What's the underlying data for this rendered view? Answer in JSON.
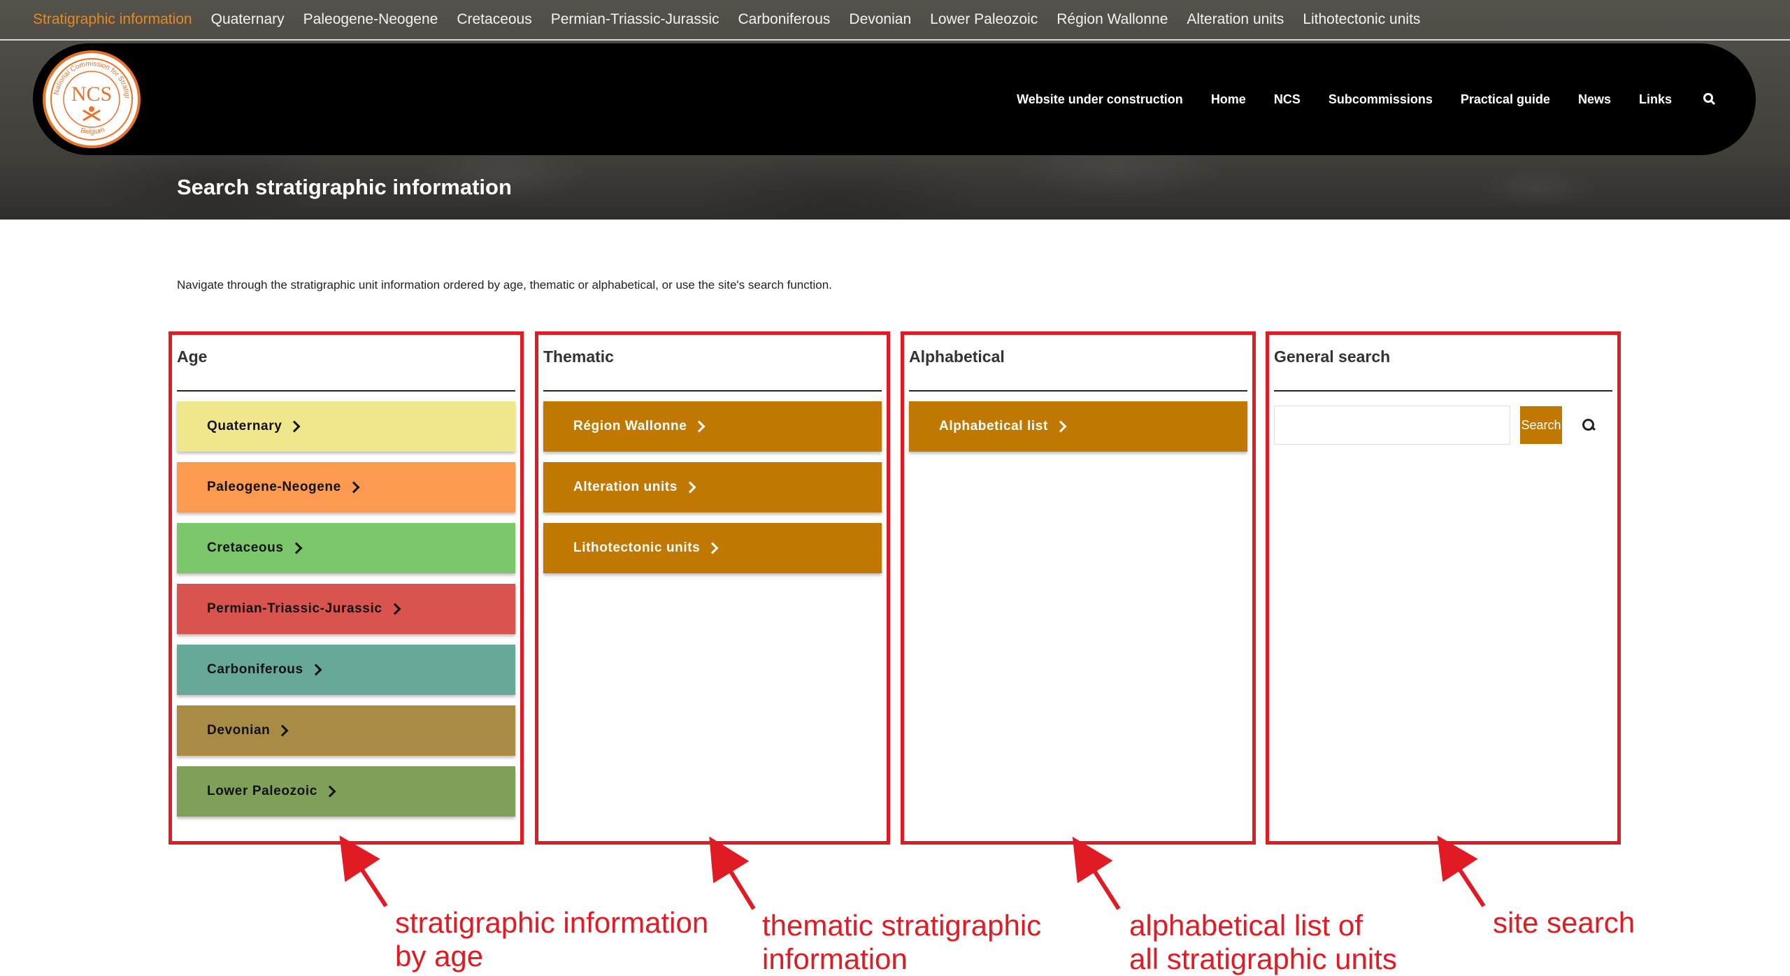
{
  "top_nav": {
    "items": [
      {
        "label": "Stratigraphic information",
        "active": true
      },
      {
        "label": "Quaternary"
      },
      {
        "label": "Paleogene-Neogene"
      },
      {
        "label": "Cretaceous"
      },
      {
        "label": "Permian-Triassic-Jurassic"
      },
      {
        "label": "Carboniferous"
      },
      {
        "label": "Devonian"
      },
      {
        "label": "Lower Paleozoic"
      },
      {
        "label": "Région Wallonne"
      },
      {
        "label": "Alteration units"
      },
      {
        "label": "Lithotectonic units"
      }
    ]
  },
  "logo": {
    "text": "NCS",
    "ring_text": "National Commission for Stratigraphy",
    "ring_text_bottom": "Belgium"
  },
  "main_nav": {
    "items": [
      "Website under construction",
      "Home",
      "NCS",
      "Subcommissions",
      "Practical guide",
      "News",
      "Links"
    ],
    "search_icon": "search-icon"
  },
  "page": {
    "title": "Search stratigraphic information",
    "intro": "Navigate through the stratigraphic unit information ordered by age, thematic or alphabetical, or use the site's search function."
  },
  "panels": {
    "age": {
      "title": "Age",
      "buttons": [
        {
          "label": "Quaternary",
          "color": "#f0e68c"
        },
        {
          "label": "Paleogene-Neogene",
          "color": "#fd9a52"
        },
        {
          "label": "Cretaceous",
          "color": "#7cc66b"
        },
        {
          "label": "Permian-Triassic-Jurassic",
          "color": "#d9534f"
        },
        {
          "label": "Carboniferous",
          "color": "#67a899"
        },
        {
          "label": "Devonian",
          "color": "#a88c46"
        },
        {
          "label": "Lower Paleozoic",
          "color": "#80a05a"
        }
      ]
    },
    "thematic": {
      "title": "Thematic",
      "buttons": [
        {
          "label": "Région Wallonne",
          "color": "#c07800"
        },
        {
          "label": "Alteration units",
          "color": "#c07800"
        },
        {
          "label": "Lithotectonic units",
          "color": "#c07800"
        }
      ]
    },
    "alphabetical": {
      "title": "Alphabetical",
      "buttons": [
        {
          "label": "Alphabetical list",
          "color": "#c07800"
        }
      ]
    },
    "search": {
      "title": "General search",
      "input_value": "",
      "button_label": "Search"
    }
  },
  "annotations": {
    "age": "stratigraphic information\nby age",
    "thematic": "thematic stratigraphic\ninformation",
    "alphabetical": "alphabetical list of\nall stratigraphic units",
    "search": "site search",
    "color": "#e01b24"
  }
}
